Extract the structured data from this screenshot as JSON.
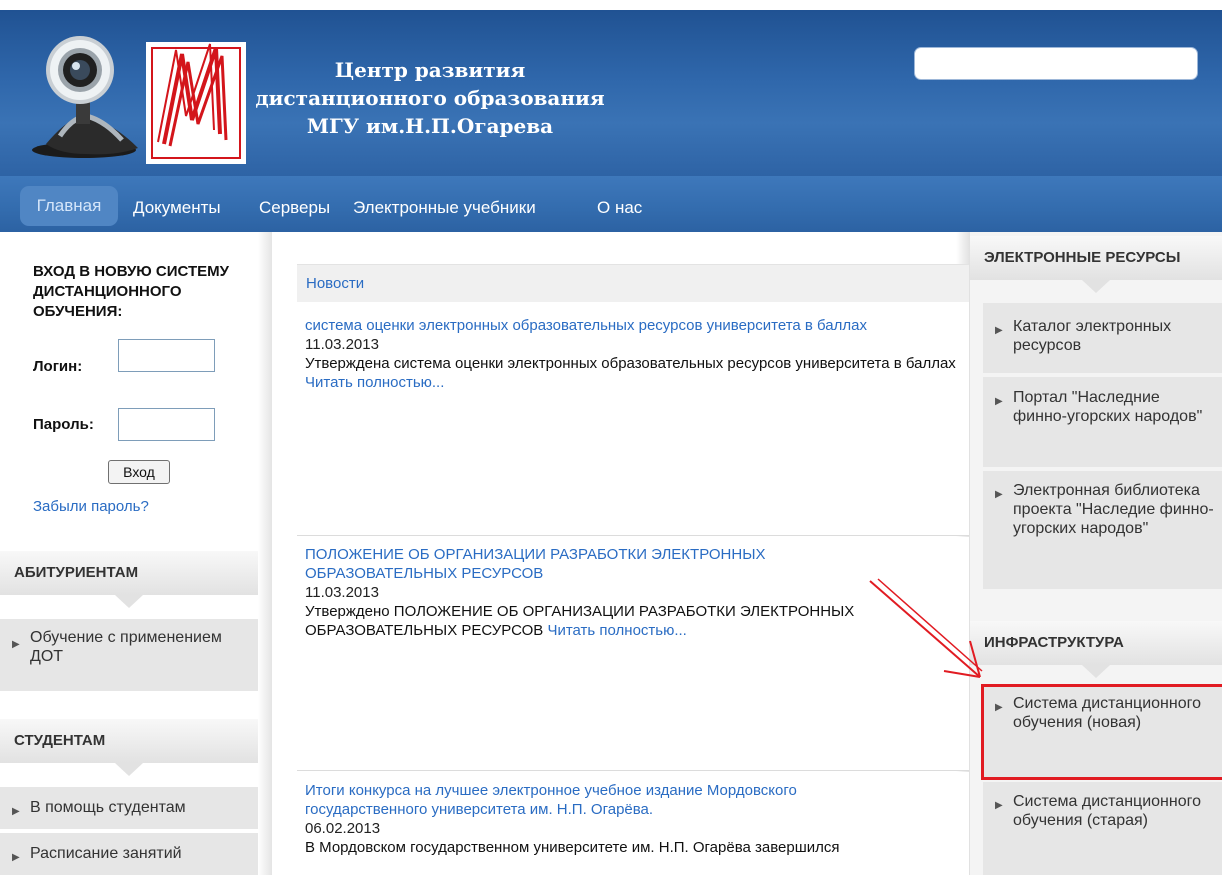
{
  "header": {
    "title_lines": [
      "Центр развития",
      "дистанционного образования",
      "МГУ им.Н.П.Огарева"
    ],
    "search": {
      "value": "",
      "placeholder": ""
    }
  },
  "nav": {
    "items": [
      {
        "label": "Главная"
      },
      {
        "label": "Документы"
      },
      {
        "label": "Серверы"
      },
      {
        "label": "Электронные учебники"
      },
      {
        "label": "О нас"
      }
    ]
  },
  "login": {
    "heading": "ВХОД В НОВУЮ СИСТЕМУ ДИСТАНЦИОННОГО ОБУЧЕНИЯ:",
    "login_label": "Логин:",
    "password_label": "Пароль:",
    "login_value": "",
    "password_value": "",
    "submit_label": "Вход",
    "forgot_label": "Забыли пароль?"
  },
  "left": {
    "applicants": {
      "title": "АБИТУРИЕНТАМ",
      "items": [
        "Обучение с применением ДОТ"
      ]
    },
    "students": {
      "title": "СТУДЕНТАМ",
      "items": [
        "В помощь студентам",
        "Расписание занятий"
      ]
    }
  },
  "news": {
    "title": "Новости",
    "read_more": "Читать полностью...",
    "items": [
      {
        "title": "система оценки электронных образовательных ресурсов университета в баллах",
        "date": "11.03.2013",
        "text": "Утверждена система оценки электронных образовательных ресурсов университета в баллах"
      },
      {
        "title": "ПОЛОЖЕНИЕ ОБ ОРГАНИЗАЦИИ РАЗРАБОТКИ ЭЛЕКТРОННЫХ ОБРАЗОВАТЕЛЬНЫХ РЕСУРСОВ",
        "date": "11.03.2013",
        "text": "Утверждено ПОЛОЖЕНИЕ ОБ ОРГАНИЗАЦИИ РАЗРАБОТКИ ЭЛЕКТРОННЫХ ОБРАЗОВАТЕЛЬНЫХ РЕСУРСОВ"
      },
      {
        "title": "Итоги конкурса на лучшее электронное учебное издание Мордовского государственного университета им. Н.П. Огарёва.",
        "date": "06.02.2013",
        "text": "В Мордовском государственном университете им. Н.П. Огарёва завершился"
      }
    ]
  },
  "right": {
    "resources": {
      "title": "ЭЛЕКТРОННЫЕ РЕСУРСЫ",
      "items": [
        "Каталог электронных ресурсов",
        "Портал \"Наследние финно-угорских народов\"",
        "Электронная библиотека проекта \"Наследие финно-угорских народов\""
      ]
    },
    "infra": {
      "title": "ИНФРАСТРУКТУРА",
      "items": [
        "Система дистанционного обучения (новая)",
        "Система дистанционного обучения (старая)"
      ]
    }
  },
  "colors": {
    "header_blue": "#2f67ab",
    "nav_blue": "#336cae",
    "link_blue": "#2a6cc3",
    "logo_red": "#d3151b",
    "highlight_red": "#e11b22"
  }
}
